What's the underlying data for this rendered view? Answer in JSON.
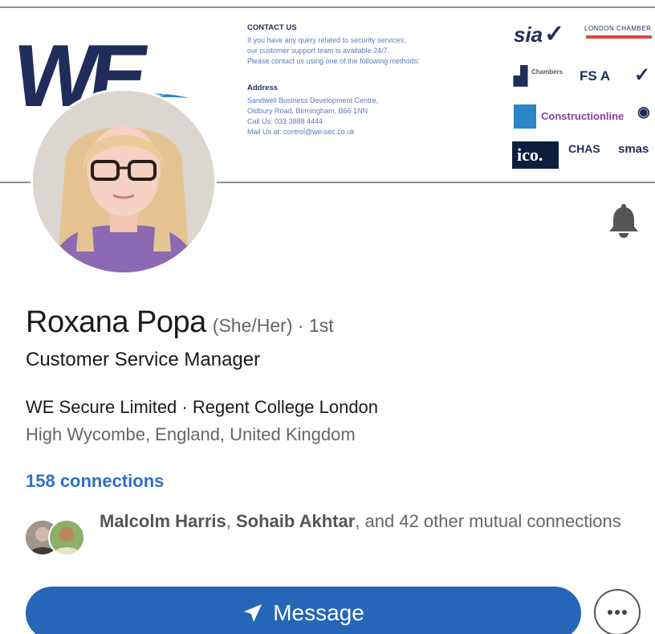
{
  "banner": {
    "logo_text": "WE",
    "logo_tagline": "A Commitment of Trust",
    "contact": {
      "heading": "CONTACT US",
      "lines": [
        "If you have any query related to security services,",
        "our customer support team is available 24/7.",
        "Please contact us using one of the following methods:"
      ],
      "address_heading": "Address",
      "address_lines": [
        "Sandwell Business Development Centre,",
        "Oldbury Road, Birmingham, B66 1NN",
        "Call Us: 033 3888 4444",
        "Mail Us at: control@we-sec.co.uk"
      ]
    },
    "badges": {
      "sia": "sia",
      "london_chamber": "LONDON CHAMBER",
      "chambers": "Chambers",
      "fsa": "FS A",
      "constructionline": "Constructionline",
      "ico": "ico.",
      "chas": "CHAS",
      "smas": "smas"
    }
  },
  "profile": {
    "name": "Roxana Popa",
    "pronouns": "(She/Her) · 1st",
    "headline": "Customer Service Manager",
    "company": "WE Secure Limited · Regent College London",
    "location": "High Wycombe, England, United Kingdom",
    "connections": "158 connections",
    "mutual": {
      "name1": "Malcolm Harris",
      "sep": ", ",
      "name2": "Sohaib Akhtar",
      "rest": ", and 42 other mutual connections"
    }
  },
  "actions": {
    "message_label": "Message"
  },
  "icons": {
    "bell": "bell-icon",
    "send": "send-icon",
    "more": "more-horizontal-icon"
  },
  "colors": {
    "primary": "#2566b7",
    "link": "#2f6ec3",
    "navy": "#1f2d5a",
    "muted": "#666666"
  }
}
